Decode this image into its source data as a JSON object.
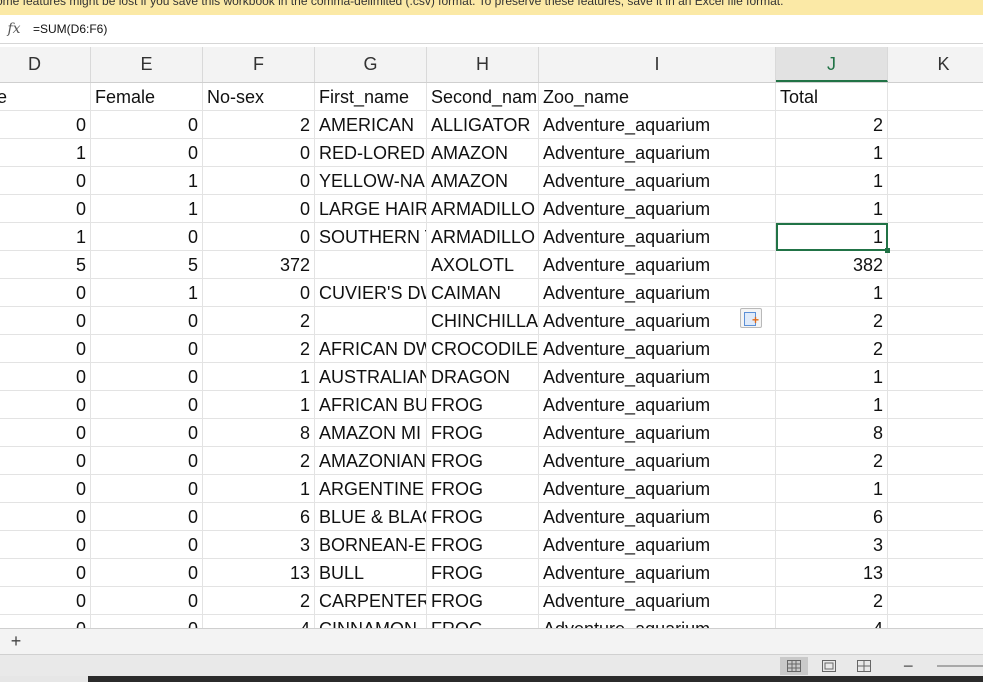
{
  "warning": {
    "text": "ome features might be lost if you save this workbook in the comma-delimited (.csv) format. To preserve these features, save it in an Excel file format."
  },
  "formula_bar": {
    "fx_label": "fx",
    "formula": "=SUM(D6:F6)"
  },
  "columns": [
    "D",
    "E",
    "F",
    "G",
    "H",
    "I",
    "J",
    "K"
  ],
  "active_column": "J",
  "header_row": [
    "ale",
    "Female",
    "No-sex",
    "First_name",
    "Second_nam",
    "Zoo_name",
    "Total"
  ],
  "rows": [
    [
      "0",
      "0",
      "2",
      "AMERICAN",
      "ALLIGATOR",
      "Adventure_aquarium",
      "2"
    ],
    [
      "1",
      "0",
      "0",
      "RED-LORED",
      "AMAZON",
      "Adventure_aquarium",
      "1"
    ],
    [
      "0",
      "1",
      "0",
      "YELLOW-NAP",
      "AMAZON",
      "Adventure_aquarium",
      "1"
    ],
    [
      "0",
      "1",
      "0",
      "LARGE HAIRY",
      "ARMADILLO",
      "Adventure_aquarium",
      "1"
    ],
    [
      "1",
      "0",
      "0",
      "SOUTHERN T",
      "ARMADILLO",
      "Adventure_aquarium",
      "1"
    ],
    [
      "5",
      "5",
      "372",
      "",
      "AXOLOTL",
      "Adventure_aquarium",
      "382"
    ],
    [
      "0",
      "1",
      "0",
      "CUVIER'S DW",
      "CAIMAN",
      "Adventure_aquarium",
      "1"
    ],
    [
      "0",
      "0",
      "2",
      "",
      "CHINCHILLA",
      "Adventure_aquarium",
      "2"
    ],
    [
      "0",
      "0",
      "2",
      "AFRICAN DW",
      "CROCODILE",
      "Adventure_aquarium",
      "2"
    ],
    [
      "0",
      "0",
      "1",
      "AUSTRALIAN",
      "DRAGON",
      "Adventure_aquarium",
      "1"
    ],
    [
      "0",
      "0",
      "1",
      "AFRICAN BUI",
      "FROG",
      "Adventure_aquarium",
      "1"
    ],
    [
      "0",
      "0",
      "8",
      "AMAZON MI",
      "FROG",
      "Adventure_aquarium",
      "8"
    ],
    [
      "0",
      "0",
      "2",
      "AMAZONIAN",
      "FROG",
      "Adventure_aquarium",
      "2"
    ],
    [
      "0",
      "0",
      "1",
      "ARGENTINE I",
      "FROG",
      "Adventure_aquarium",
      "1"
    ],
    [
      "0",
      "0",
      "6",
      "BLUE & BLAC",
      "FROG",
      "Adventure_aquarium",
      "6"
    ],
    [
      "0",
      "0",
      "3",
      "BORNEAN-EA",
      "FROG",
      "Adventure_aquarium",
      "3"
    ],
    [
      "0",
      "0",
      "13",
      "BULL",
      "FROG",
      "Adventure_aquarium",
      "13"
    ],
    [
      "0",
      "0",
      "2",
      "CARPENTER",
      "FROG",
      "Adventure_aquarium",
      "2"
    ],
    [
      "0",
      "0",
      "4",
      "CINNAMON",
      "FROG",
      "Adventure_aquarium",
      "4"
    ]
  ],
  "selected_cell": {
    "row": 4,
    "col": 6
  },
  "sheet_bar": {
    "add_label": "+"
  },
  "status_bar": {
    "zoom_minus": "−"
  }
}
